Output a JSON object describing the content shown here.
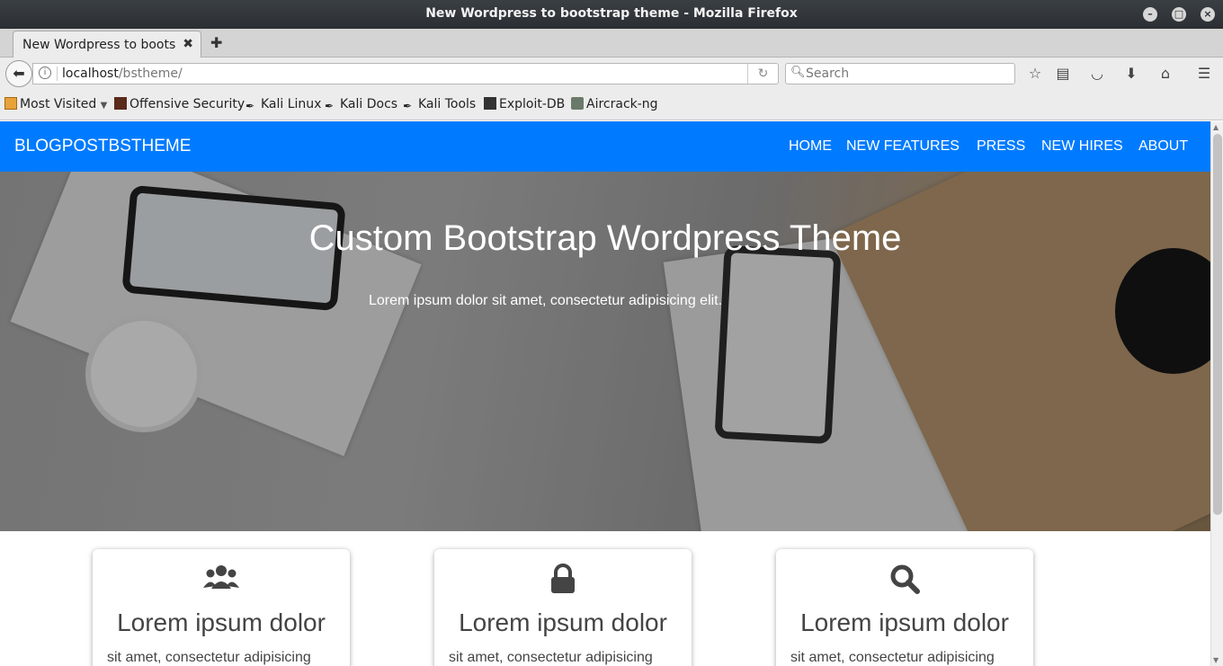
{
  "window": {
    "title": "New Wordpress to bootstrap theme - Mozilla Firefox"
  },
  "tabs": [
    {
      "label": "New Wordpress to boots..."
    }
  ],
  "urlbar": {
    "host": "localhost",
    "path": "/bstheme/"
  },
  "search": {
    "placeholder": "Search"
  },
  "bookmarks": [
    "Most Visited",
    "Offensive Security",
    "Kali Linux",
    "Kali Docs",
    "Kali Tools",
    "Exploit-DB",
    "Aircrack-ng"
  ],
  "site": {
    "brand": "BLOGPOSTBSTHEME",
    "nav": [
      "HOME",
      "NEW FEATURES",
      "PRESS",
      "NEW HIRES",
      "ABOUT"
    ],
    "nav_color": "#007bff",
    "hero": {
      "title": "Custom Bootstrap Wordpress Theme",
      "subtitle": "Lorem ipsum dolor sit amet, consectetur adipisicing elit."
    },
    "cards": [
      {
        "icon": "users-icon",
        "title": "Lorem ipsum dolor",
        "text": "sit amet, consectetur adipisicing"
      },
      {
        "icon": "lock-icon",
        "title": "Lorem ipsum dolor",
        "text": "sit amet, consectetur adipisicing"
      },
      {
        "icon": "search-icon",
        "title": "Lorem ipsum dolor",
        "text": "sit amet, consectetur adipisicing"
      }
    ]
  }
}
